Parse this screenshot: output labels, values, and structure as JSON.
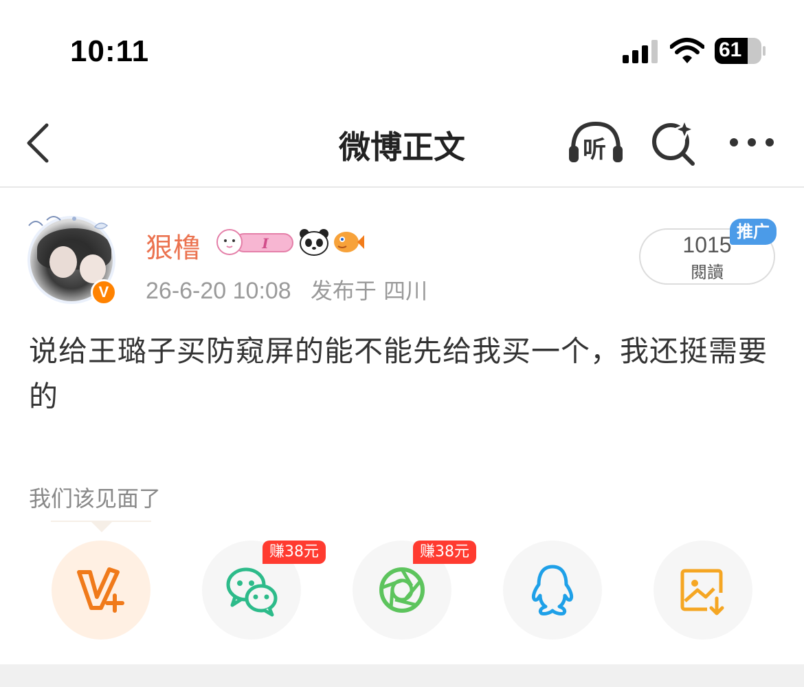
{
  "status_bar": {
    "time": "10:11",
    "battery": "61"
  },
  "nav": {
    "title": "微博正文",
    "listen_label": "听"
  },
  "post": {
    "username": "狠橹",
    "timestamp": "26-6-20 10:08",
    "location": "发布于 四川",
    "verified_badge": "V",
    "read_count": "1015",
    "read_label": "閱讀",
    "promo_tag": "推广",
    "body": "说给王璐子买防窥屏的能不能先给我买一个，我还挺需要的",
    "hint": "我们该见面了"
  },
  "share": {
    "earn_tag_1": "赚38元",
    "earn_tag_2": "赚38元",
    "items": [
      {
        "name": "weibo-v-plus",
        "icon": "v-plus-icon"
      },
      {
        "name": "wechat",
        "icon": "wechat-icon"
      },
      {
        "name": "moments",
        "icon": "moments-icon"
      },
      {
        "name": "qq",
        "icon": "qq-icon"
      },
      {
        "name": "save-image",
        "icon": "save-image-icon"
      }
    ]
  },
  "colors": {
    "username": "#eb7350",
    "verified": "#ff8200",
    "promo": "#4b9be8",
    "earn_tag": "#ff3b30",
    "wechat": "#2dbb8a",
    "moments": "#5dc45d",
    "qq": "#1ea0e8",
    "save": "#f5a623"
  }
}
